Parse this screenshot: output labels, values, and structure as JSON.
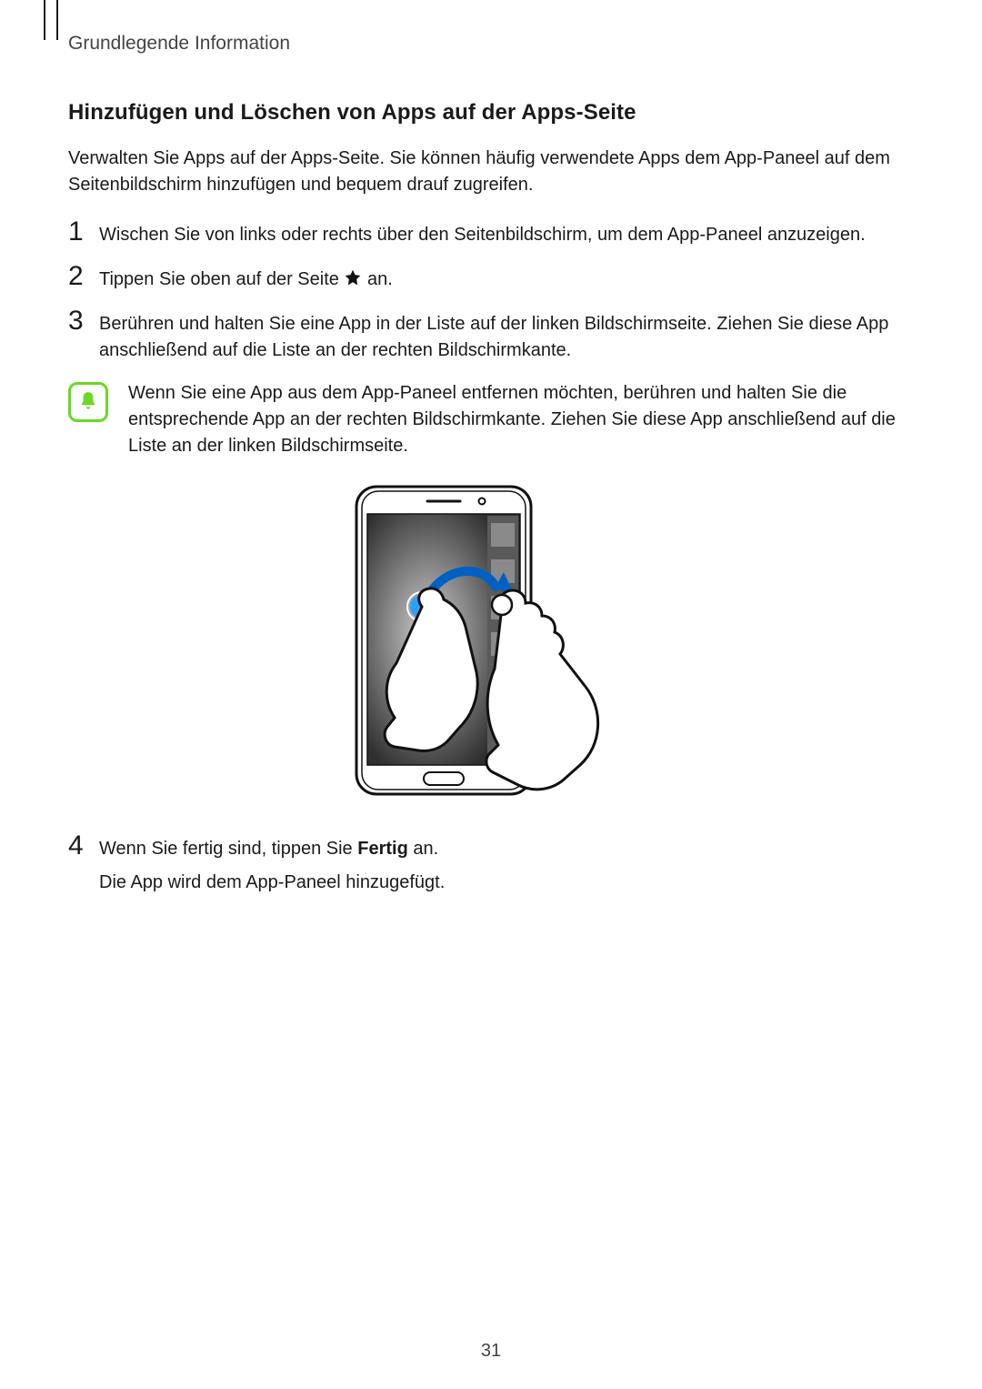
{
  "sectionLabel": "Grundlegende Information",
  "heading": "Hinzufügen und Löschen von Apps auf der Apps-Seite",
  "intro": "Verwalten Sie Apps auf der Apps-Seite. Sie können häufig verwendete Apps dem App-Paneel auf dem Seitenbildschirm hinzufügen und bequem drauf zugreifen.",
  "steps": {
    "1": {
      "num": "1",
      "text": "Wischen Sie von links oder rechts über den Seitenbildschirm, um dem App-Paneel anzuzeigen."
    },
    "2": {
      "num": "2",
      "before": "Tippen Sie oben auf der Seite ",
      "after": " an."
    },
    "3": {
      "num": "3",
      "text": "Berühren und halten Sie eine App in der Liste auf der linken Bildschirmseite. Ziehen Sie diese App anschließend auf die Liste an der rechten Bildschirmkante."
    },
    "4a": {
      "num": "4",
      "before": "Wenn Sie fertig sind, tippen Sie ",
      "bold": "Fertig",
      "after": " an."
    },
    "4b": "Die App wird dem App-Paneel hinzugefügt."
  },
  "note": "Wenn Sie eine App aus dem App-Paneel entfernen möchten, berühren und halten Sie die entsprechende App an der rechten Bildschirmkante. Ziehen Sie diese App anschließend auf die Liste an der linken Bildschirmseite.",
  "pageNumber": "31"
}
